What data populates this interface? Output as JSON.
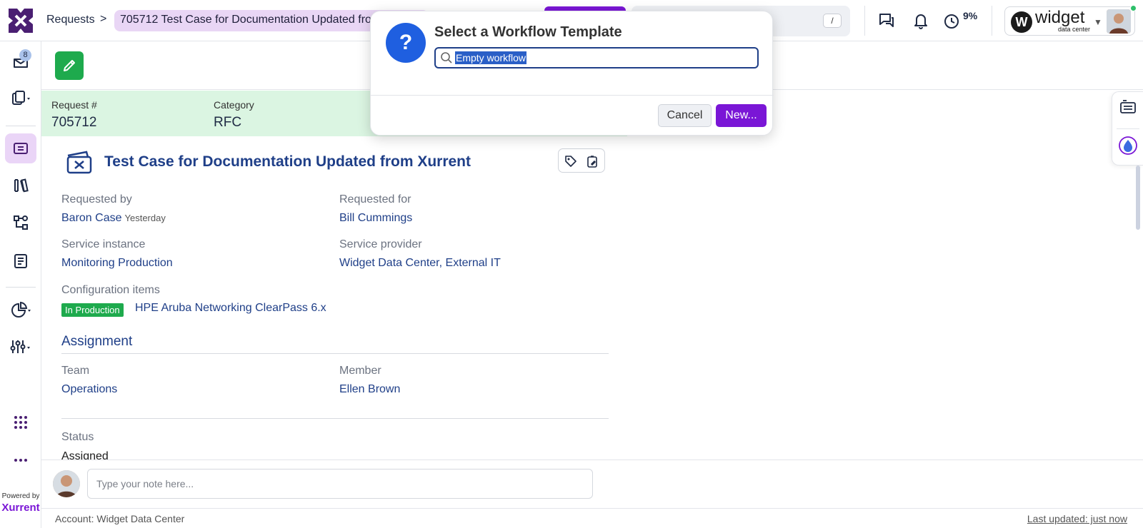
{
  "header": {
    "breadcrumb_root": "Requests",
    "breadcrumb_sep": ">",
    "breadcrumb_current": "705712  Test Case for Documentation Updated from Xurrent",
    "search_shortcut": "/",
    "time_percent": "9%",
    "account_brand": "widget",
    "account_sub": "data center"
  },
  "sidebar": {
    "inbox_badge": "8",
    "powered_by": "Powered by",
    "brand": "Xurrent"
  },
  "summary": {
    "request_label": "Request #",
    "request_value": "705712",
    "category_label": "Category",
    "category_value": "RFC"
  },
  "record": {
    "title": "Test Case for Documentation Updated from Xurrent",
    "requested_by_label": "Requested by",
    "requested_by_value": "Baron Case",
    "requested_by_when": "Yesterday",
    "requested_for_label": "Requested for",
    "requested_for_value": "Bill Cummings",
    "service_instance_label": "Service instance",
    "service_instance_value": "Monitoring Production",
    "service_provider_label": "Service provider",
    "service_provider_value": "Widget Data Center, External IT",
    "ci_label": "Configuration items",
    "ci_tag": "In Production",
    "ci_value": "HPE Aruba Networking ClearPass 6.x",
    "assignment_title": "Assignment",
    "team_label": "Team",
    "team_value": "Operations",
    "member_label": "Member",
    "member_value": "Ellen Brown",
    "status_label": "Status",
    "status_value": "Assigned"
  },
  "note": {
    "placeholder": "Type your note here..."
  },
  "footer": {
    "account": "Account: Widget Data Center",
    "last_updated": "Last updated: just now"
  },
  "modal": {
    "title": "Select a Workflow Template",
    "search_value": "Empty workflow",
    "cancel_label": "Cancel",
    "new_label": "New..."
  },
  "colors": {
    "accent": "#7a16d6",
    "primary_text": "#1f3f88",
    "success": "#1eaa4d",
    "summary_bg": "#dbf5e2"
  }
}
